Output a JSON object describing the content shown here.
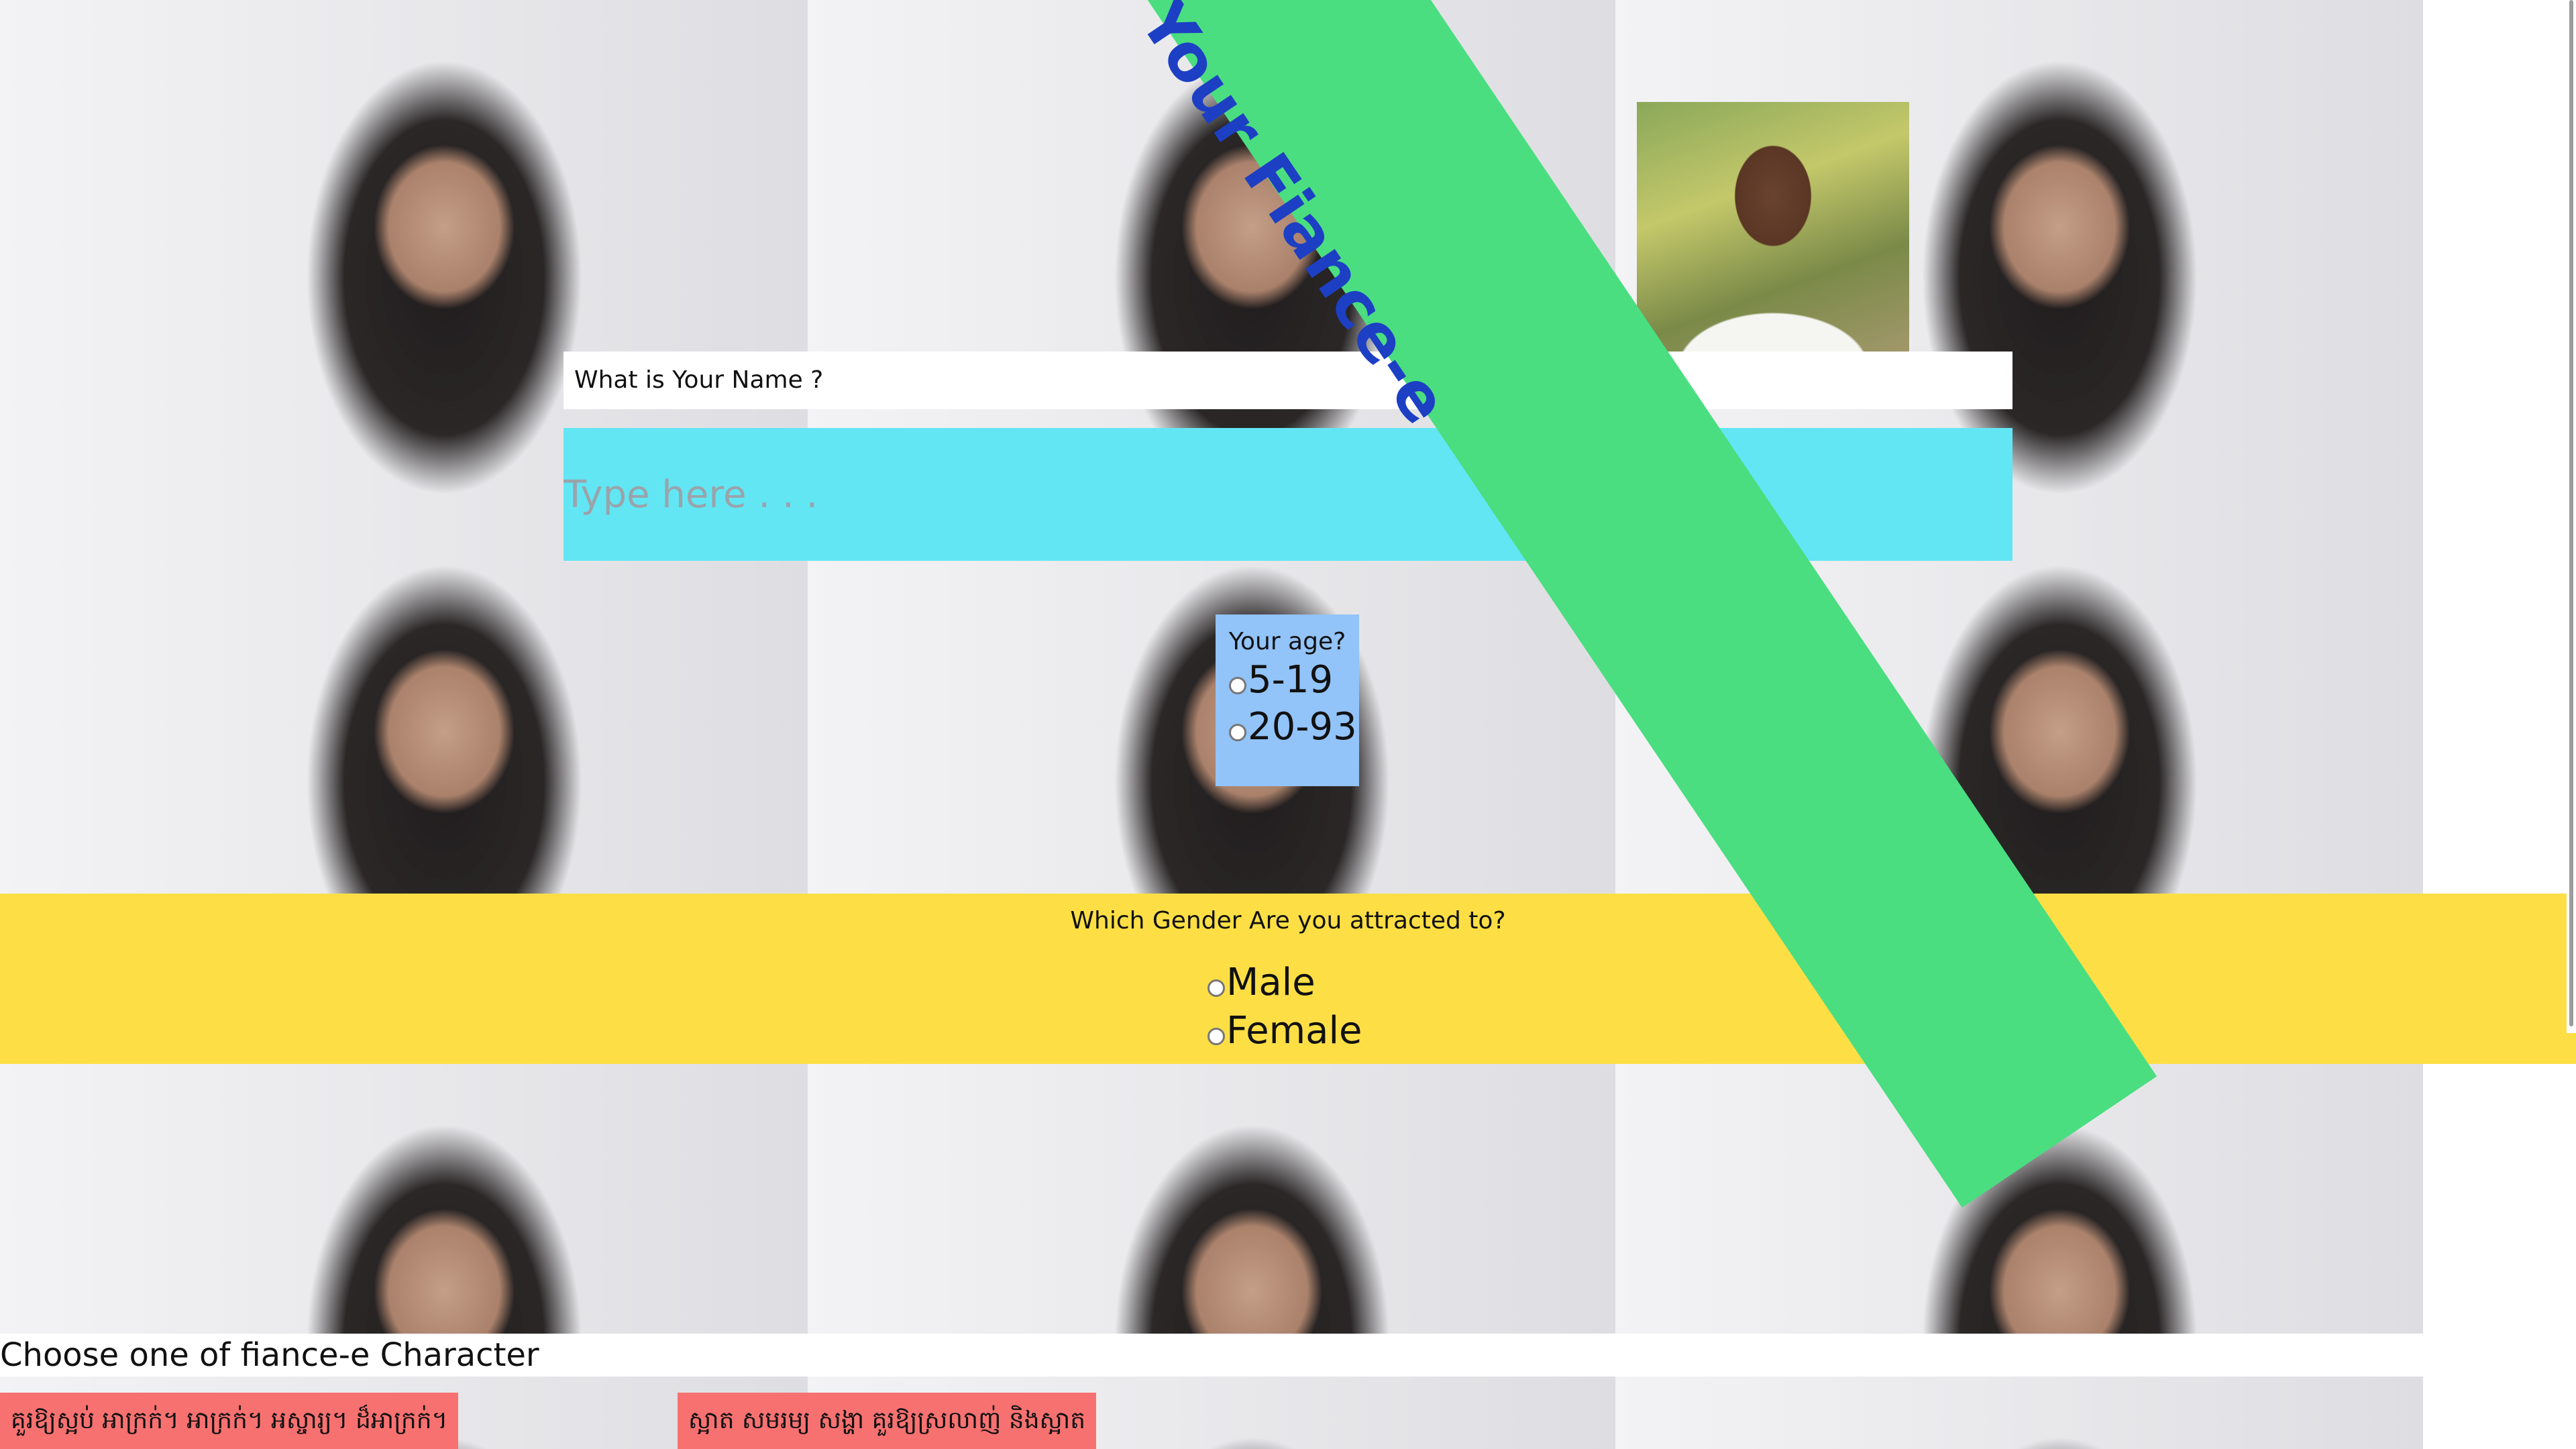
{
  "banner": {
    "text": "Your Fiance-e"
  },
  "name_section": {
    "label": "What is Your Name ?",
    "placeholder": "Type here . . ."
  },
  "age_section": {
    "title": "Your age?",
    "options": [
      "5-19",
      "20-93"
    ]
  },
  "gender_section": {
    "title": "Which Gender Are you attracted to?",
    "options": [
      "Male",
      "Female"
    ]
  },
  "character_section": {
    "title": "Choose one of fiance-e Character",
    "options": [
      "គួរឱ្យស្អប់ អាក្រក់។ អាក្រក់។ អស្ចារ្យ។ ដ៏អាក្រក់។",
      "ស្អាត សមរម្យ សង្ហា គួរឱ្យស្រលាញ់ និងស្អាត"
    ]
  },
  "colors": {
    "name_input_bg": "#62e6f4",
    "age_box_bg": "#92c3f9",
    "gender_band_bg": "#fddf45",
    "diagonal_band": "#4ade80",
    "banner_text": "#1d3fc4",
    "choice_button_bg": "#f87171"
  }
}
